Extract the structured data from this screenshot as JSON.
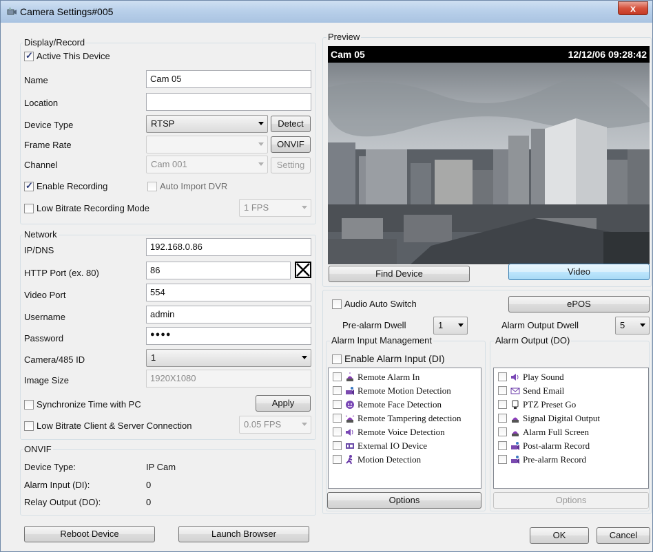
{
  "window": {
    "title": "Camera Settings#005",
    "close_label": "x"
  },
  "display_record": {
    "group_title": "Display/Record",
    "active_label": "Active This Device",
    "name_label": "Name",
    "name_value": "Cam 05",
    "location_label": "Location",
    "location_value": "",
    "device_type_label": "Device Type",
    "device_type_value": "RTSP",
    "detect_label": "Detect",
    "frame_rate_label": "Frame Rate",
    "frame_rate_value": "",
    "onvif_label": "ONVIF",
    "channel_label": "Channel",
    "channel_value": "Cam 001",
    "setting_label": "Setting",
    "enable_recording_label": "Enable Recording",
    "auto_import_label": "Auto Import DVR",
    "low_bitrate_label": "Low Bitrate Recording Mode",
    "low_bitrate_fps": "1 FPS"
  },
  "network": {
    "group_title": "Network",
    "ip_label": "IP/DNS",
    "ip_value": "192.168.0.86",
    "http_label": "HTTP Port (ex. 80)",
    "http_value": "86",
    "video_port_label": "Video Port",
    "video_port_value": "554",
    "username_label": "Username",
    "username_value": "admin",
    "password_label": "Password",
    "password_value": "●●●●",
    "camera_id_label": "Camera/485 ID",
    "camera_id_value": "1",
    "image_size_label": "Image Size",
    "image_size_value": "1920X1080",
    "sync_time_label": "Synchronize Time with PC",
    "apply_label": "Apply",
    "low_bitrate_client_label": "Low Bitrate Client & Server Connection",
    "client_fps": "0.05 FPS"
  },
  "onvif": {
    "group_title": "ONVIF",
    "device_type_label": "Device Type:",
    "device_type_value": "IP Cam",
    "alarm_input_label": "Alarm Input (DI):",
    "alarm_input_value": "0",
    "relay_output_label": "Relay Output (DO):",
    "relay_output_value": "0"
  },
  "bottom": {
    "reboot_label": "Reboot Device",
    "launch_label": "Launch Browser",
    "ok_label": "OK",
    "cancel_label": "Cancel"
  },
  "preview": {
    "group_title": "Preview",
    "cam_label": "Cam 05",
    "timestamp": "12/12/06 09:28:42",
    "find_device_label": "Find Device",
    "video_label": "Video"
  },
  "alarm": {
    "audio_switch_label": "Audio Auto Switch",
    "epos_label": "ePOS",
    "pre_alarm_label": "Pre-alarm Dwell",
    "pre_alarm_value": "1",
    "output_dwell_label": "Alarm Output Dwell",
    "output_dwell_value": "5",
    "input_group_title": "Alarm Input Management",
    "enable_input_label": "Enable Alarm Input (DI)",
    "input_items": [
      "Remote Alarm In",
      "Remote Motion Detection",
      "Remote Face Detection",
      "Remote Tampering detection",
      "Remote Voice Detection",
      "External IO Device",
      "Motion Detection"
    ],
    "input_options_label": "Options",
    "output_group_title": "Alarm Output (DO)",
    "output_items": [
      "Play Sound",
      "Send Email",
      "PTZ Preset Go",
      "Signal Digital Output",
      "Alarm Full Screen",
      "Post-alarm Record",
      "Pre-alarm Record"
    ],
    "output_options_label": "Options"
  },
  "colors": {
    "title_bar": "#b9d0ea",
    "close_button": "#d6523c",
    "focus_button": "#bee6fd"
  }
}
